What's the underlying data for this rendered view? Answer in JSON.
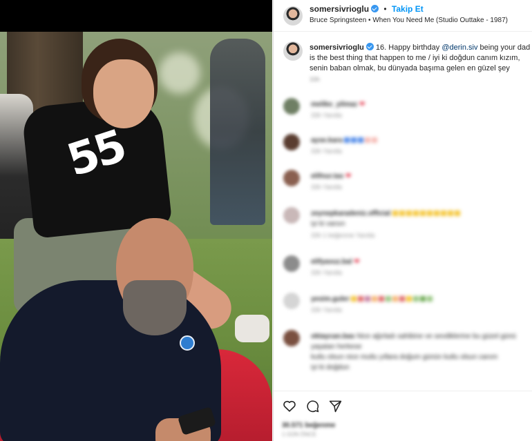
{
  "post": {
    "username": "somersivrioglu",
    "follow_label": "Takip Et",
    "separator": "•",
    "song": "Bruce Springsteen • When You Need Me (Studio Outtake - 1987)",
    "photo_shirt_text": "55"
  },
  "caption": {
    "username": "somersivrioglu",
    "text_before": " 16. Happy birthday ",
    "mention": "@derin.siv",
    "text_after": " being your dad is the best thing that happen to me / iyi ki doğdun canım kızım, senin baban olmak, bu dünyada başıma gelen en güzel şey",
    "time": "33h"
  },
  "comments": [
    {
      "user": "melike_yilmaz",
      "text": "",
      "emoji": "❤",
      "meta": "33h   Yanıtla"
    },
    {
      "user": "ayse.kara",
      "text": "",
      "emoji": "blocks-blue",
      "meta": "33h   Yanıtla"
    },
    {
      "user": "elifnur.tas",
      "text": "",
      "emoji": "❤",
      "meta": "33h   Yanıtla"
    },
    {
      "user": "zeynepkaradeniz.official",
      "text": "",
      "emoji": "blocks-yellow",
      "meta": "33h   1 beğenme   Yanıtla",
      "second_line": "iyi ki varsın"
    },
    {
      "user": "elifyavuz.bal",
      "text": "",
      "emoji": "❤",
      "meta": "33h   Yanıtla"
    },
    {
      "user": "yesim.guler",
      "text": "",
      "emoji": "blocks-multi",
      "meta": "33h   Yanıtla"
    },
    {
      "user": "oktaycan.bas",
      "text": "Nice ağırladı sahibine ve sevdiklerine bu güzel günü yaşatan herkese",
      "emoji": "",
      "meta": "",
      "second_line": "kutlu olsun nice mutlu yıllara doğum günün kutlu olsun canım",
      "third_line": "iyi ki doğdun"
    }
  ],
  "actions": {
    "like_icon": "heart-icon",
    "comment_icon": "comment-icon",
    "share_icon": "share-icon",
    "likes": "30.571 beğenme",
    "date": "1 GÜN ÖNCE"
  },
  "colors": {
    "accent": "#0095f6",
    "verified": "#3897f0",
    "mention": "#00376b"
  }
}
